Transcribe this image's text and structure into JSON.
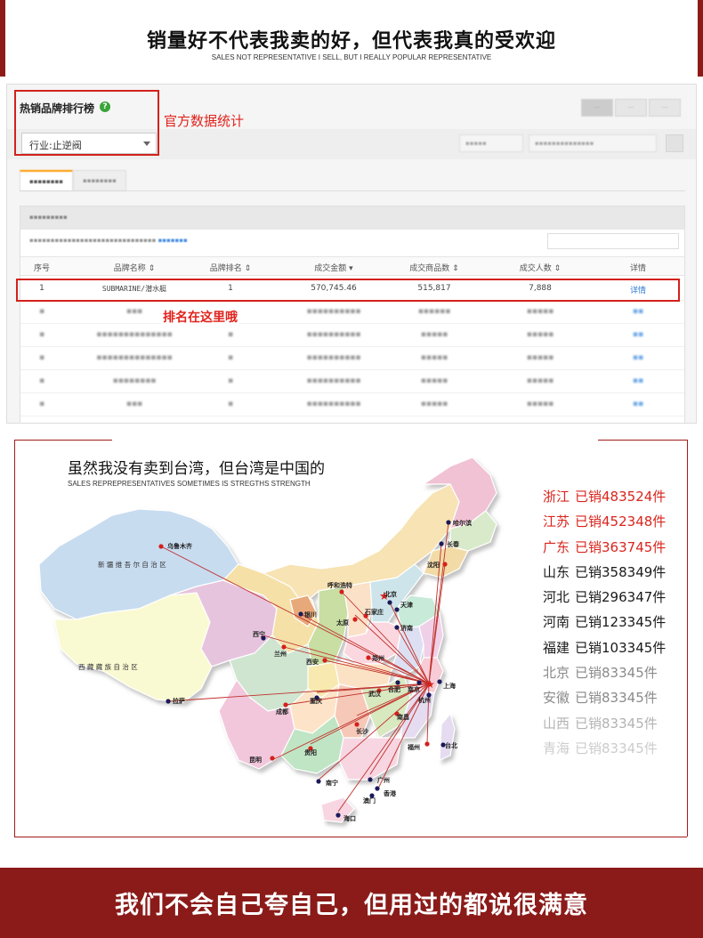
{
  "header": {
    "title": "销量好不代表我卖的好，但代表我真的受欢迎",
    "subtitle": "SALES NOT REPRESENTATIVE I SELL, BUT I REALLY POPULAR REPRESENTATIVE"
  },
  "ranking_panel": {
    "title": "热销品牌排行榜",
    "help_icon": "help-icon",
    "official_label": "官方数据统计",
    "industry_select": "行业:止逆阀",
    "rank_note": "排名在这里哦",
    "columns": [
      "序号",
      "品牌名称",
      "品牌排名",
      "成交金额",
      "成交商品数",
      "成交人数",
      "详情"
    ],
    "highlight_row": {
      "no": "1",
      "brand": "SUBMARINE/潜水艇",
      "rank": "1",
      "amount": "570,745.46",
      "items": "515,817",
      "buyers": "7,888",
      "detail": "详情"
    }
  },
  "map_section": {
    "title": "虽然我没有卖到台湾，但台湾是中国的",
    "subtitle": "SALES REPREPRESENTATIVES SOMETIMES IS STREGTHS STRENGTH",
    "regions": {
      "xinjiang": "新 疆 维 吾 尔 自 治 区",
      "tibet": "西 藏 藏 族 自 治 区"
    },
    "cities": {
      "urumqi": "乌鲁木齐",
      "harbin": "哈尔滨",
      "changchun": "长春",
      "shenyang": "沈阳",
      "hohhot": "呼和浩特",
      "beijing": "北京",
      "tianjin": "天津",
      "shijiazhuang": "石家庄",
      "yinchuan": "银川",
      "taiyuan": "太原",
      "jinan": "济南",
      "xining": "西宁",
      "lanzhou": "兰州",
      "xian": "西安",
      "zhengzhou": "郑州",
      "hefei": "合肥",
      "nanjing": "南京",
      "shanghai": "上海",
      "lhasa": "拉萨",
      "wuhan": "武汉",
      "hangzhou": "杭州",
      "chengdu": "成都",
      "chongqing": "重庆",
      "nanchang": "南昌",
      "changsha": "长沙",
      "fuzhou": "福州",
      "taibei": "台北",
      "guiyang": "贵阳",
      "kunming": "昆明",
      "guangzhou": "广州",
      "nanning": "南宁",
      "hongkong": "香港",
      "macau": "澳门",
      "haikou": "海口"
    },
    "sales": [
      {
        "province": "浙江",
        "text": "已销483524件",
        "color": "#d9251d"
      },
      {
        "province": "江苏",
        "text": "已销452348件",
        "color": "#d9251d"
      },
      {
        "province": "广东",
        "text": "已销363745件",
        "color": "#d9251d"
      },
      {
        "province": "山东",
        "text": "已销358349件",
        "color": "#1a1a1a"
      },
      {
        "province": "河北",
        "text": "已销296347件",
        "color": "#1a1a1a"
      },
      {
        "province": "河南",
        "text": "已销123345件",
        "color": "#1a1a1a"
      },
      {
        "province": "福建",
        "text": "已销103345件",
        "color": "#1a1a1a"
      },
      {
        "province": "北京",
        "text": "已销83345件",
        "color": "#8a8a8a"
      },
      {
        "province": "安徽",
        "text": "已销83345件",
        "color": "#8a8a8a"
      },
      {
        "province": "山西",
        "text": "已销83345件",
        "color": "#b3b3b3"
      },
      {
        "province": "青海",
        "text": "已销83345件",
        "color": "#cccccc"
      }
    ]
  },
  "footer": {
    "slogan": "我们不会自己夸自己，但用过的都说很满意"
  }
}
